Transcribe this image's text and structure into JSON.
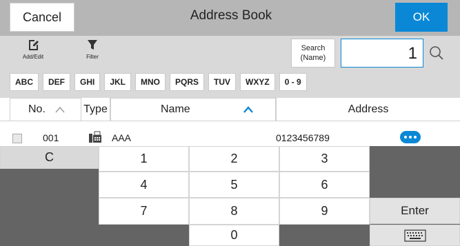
{
  "titlebar": {
    "cancel_label": "Cancel",
    "title": "Address Book",
    "ok_label": "OK"
  },
  "toolbar": {
    "add_edit_label": "Add/Edit",
    "filter_label": "Filter",
    "search_name_line1": "Search",
    "search_name_line2": "(Name)",
    "search_value": "1"
  },
  "filters": [
    "ABC",
    "DEF",
    "GHI",
    "JKL",
    "MNO",
    "PQRS",
    "TUV",
    "WXYZ",
    "0 - 9"
  ],
  "table": {
    "headers": {
      "no": "No.",
      "type": "Type",
      "name": "Name",
      "address": "Address"
    },
    "rows": [
      {
        "no": "001",
        "name": "AAA",
        "address": "0123456789"
      }
    ]
  },
  "keypad": {
    "clear": "C",
    "keys": [
      "1",
      "2",
      "3",
      "4",
      "5",
      "6",
      "7",
      "8",
      "9",
      "0"
    ],
    "enter": "Enter"
  },
  "colors": {
    "accent": "#0a88d6",
    "titlebar_bg": "#b6b6b6",
    "toolbar_bg": "#d9d9d9",
    "keypad_bg": "#646464"
  }
}
